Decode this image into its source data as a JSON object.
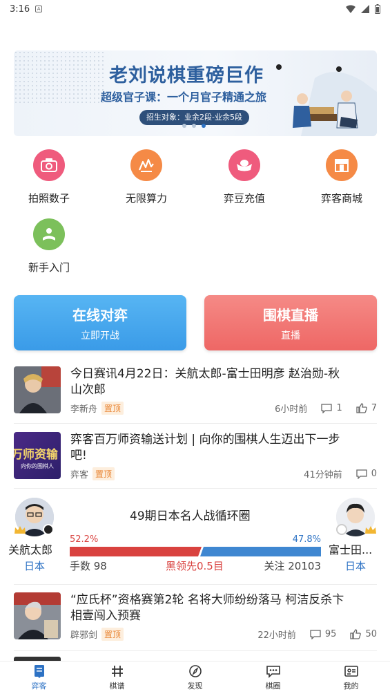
{
  "status_bar": {
    "time": "3:16",
    "notif_icon": "A"
  },
  "banner": {
    "title": "老刘说棋重磅巨作",
    "subtitle": "超级官子课：一个月官子精通之旅",
    "tag": "招生对象：业余2段-业余5段"
  },
  "features": [
    {
      "label": "拍照数子",
      "icon": "camera-icon",
      "color": "#ef5b7d"
    },
    {
      "label": "无限算力",
      "icon": "compute-icon",
      "color": "#f58a46"
    },
    {
      "label": "弈豆充值",
      "icon": "ingot-icon",
      "color": "#ef5b7d"
    },
    {
      "label": "弈客商城",
      "icon": "shop-icon",
      "color": "#f58a46"
    },
    {
      "label": "新手入门",
      "icon": "beginner-icon",
      "color": "#7cc05b"
    }
  ],
  "actions": {
    "online": {
      "title": "在线对弈",
      "sub": "立即开战"
    },
    "live": {
      "title": "围棋直播",
      "sub": "直播"
    }
  },
  "news": [
    {
      "headline": "今日赛讯4月22日：关航太郎-富士田明彦 赵治勋-秋山次郎",
      "author": "李新舟",
      "pin": "置顶",
      "time": "6小时前",
      "comments": "1",
      "likes": "7"
    },
    {
      "headline": "弈客百万师资输送计划 | 向你的围棋人生迈出下一步吧!",
      "author": "弈客",
      "pin": "置顶",
      "time": "41分钟前",
      "comments": "0",
      "thumb_text": "万师资输",
      "thumb_sub": "向你的围棋人"
    },
    {
      "headline": "“应氏杯”资格赛第2轮 名将大师纷纷落马 柯洁反杀卞相壹闯入预赛",
      "author": "辟邪剑",
      "pin": "置顶",
      "time": "22小时前",
      "comments": "95",
      "likes": "50"
    }
  ],
  "match": {
    "title": "49期日本名人战循环圈",
    "black": {
      "name": "关航太郎",
      "country": "日本",
      "pct": "52.2%",
      "share": 0.522
    },
    "white": {
      "name": "富士田...",
      "country": "日本",
      "pct": "47.8%",
      "share": 0.478
    },
    "moves": "手数 98",
    "lead": "黑领先0.5目",
    "follow": "关注 20103"
  },
  "bottom_nav": [
    {
      "label": "弈客",
      "icon": "home-icon",
      "active": true
    },
    {
      "label": "棋谱",
      "icon": "board-icon",
      "active": false
    },
    {
      "label": "发现",
      "icon": "compass-icon",
      "active": false
    },
    {
      "label": "棋圈",
      "icon": "community-icon",
      "active": false
    },
    {
      "label": "我的",
      "icon": "profile-icon",
      "active": false
    }
  ]
}
